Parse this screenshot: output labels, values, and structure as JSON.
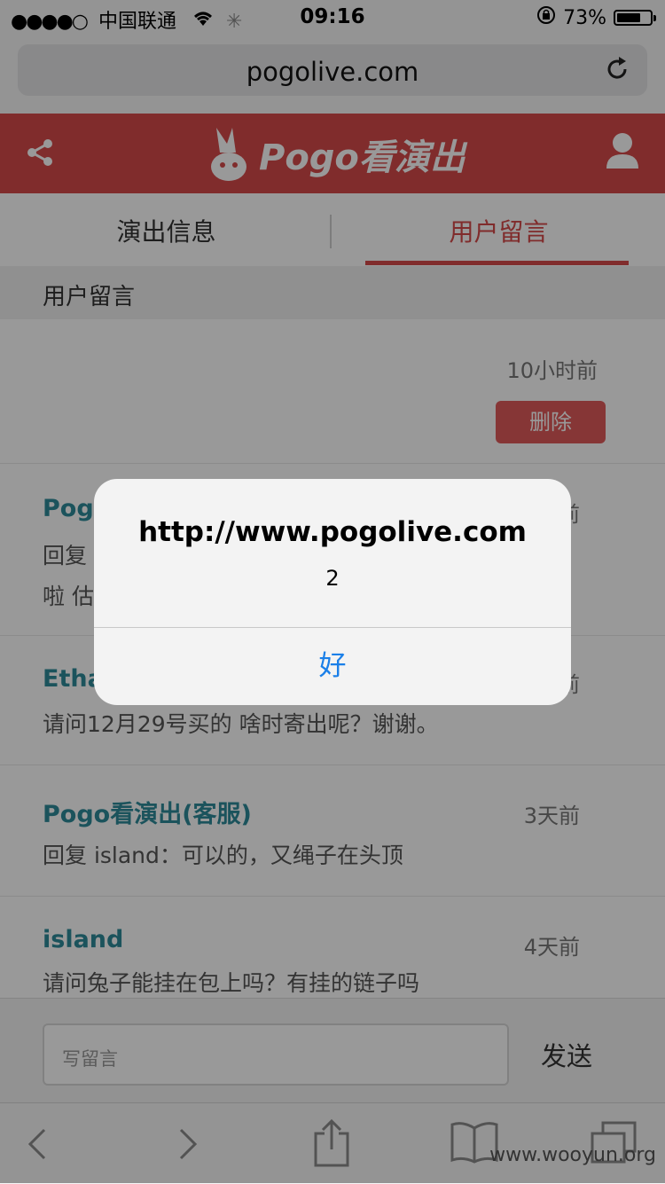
{
  "status_bar": {
    "signal_dots": "●●●●○",
    "carrier": "中国联通",
    "time": "09:16",
    "battery_pct": "73%",
    "battery_level": 0.73
  },
  "browser": {
    "url": "pogolive.com"
  },
  "header": {
    "logo_text": "Pogo看演出",
    "brand_color": "#d64a4a"
  },
  "tabs": [
    {
      "label": "演出信息",
      "active": false
    },
    {
      "label": "用户留言",
      "active": true
    }
  ],
  "section_title": "用户留言",
  "messages": [
    {
      "name": "",
      "time": "10小时前",
      "body_lines": [],
      "delete_label": "删除"
    },
    {
      "name": "Pogo",
      "time": "前",
      "body_lines": [
        "回复",
        "啦 估"
      ]
    },
    {
      "name": "Etha",
      "time": "前",
      "body_lines": [
        "请问12月29号买的 啥时寄出呢？谢谢。"
      ]
    },
    {
      "name": "Pogo看演出(客服)",
      "time": "3天前",
      "body_lines": [
        "回复 island：可以的，又绳子在头顶"
      ]
    },
    {
      "name": "island",
      "time": "4天前",
      "body_lines": [
        "请问兔子能挂在包上吗？有挂的链子吗"
      ]
    }
  ],
  "comment": {
    "placeholder": "写留言",
    "send_label": "发送"
  },
  "watermark": "www.wooyun.org",
  "alert": {
    "title": "http://www.pogolive.com",
    "message": "2",
    "button_label": "好",
    "button_color": "#1a7fe8"
  }
}
